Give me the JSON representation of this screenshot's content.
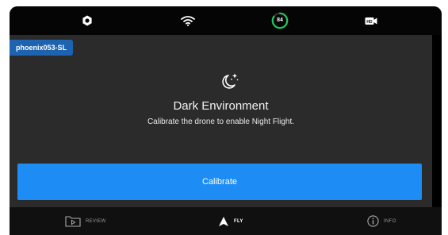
{
  "status_bar": {
    "settings_icon": "gear-icon",
    "wifi_icon": "wifi-icon",
    "battery_level": "84",
    "battery_color": "#22c55e",
    "camera_icon": "hd-video-camera-icon"
  },
  "drone": {
    "name": "phoenix053-SL"
  },
  "alert": {
    "icon": "moon-stars-icon",
    "title": "Dark Environment",
    "message": "Calibrate the drone to enable Night Flight.",
    "button_label": "Calibrate",
    "button_color": "#1d8df5"
  },
  "nav": {
    "items": [
      {
        "label": "REVIEW",
        "icon": "play-folder-icon",
        "active": false
      },
      {
        "label": "FLY",
        "icon": "arrow-up-icon",
        "active": true
      },
      {
        "label": "INFO",
        "icon": "info-icon",
        "active": false
      }
    ]
  }
}
